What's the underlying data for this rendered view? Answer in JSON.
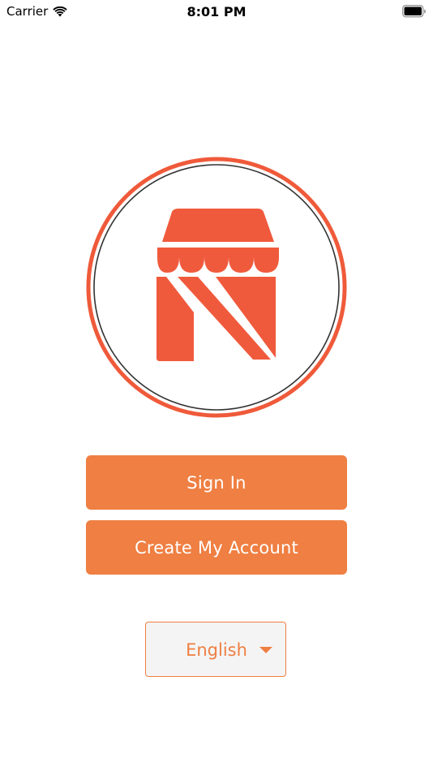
{
  "status_bar": {
    "carrier": "Carrier",
    "time": "8:01 PM",
    "icons": [
      "wifi-icon",
      "battery-icon"
    ]
  },
  "logo": {
    "icon": "storefront-logo-icon",
    "colors": {
      "ring": "#ef5a3a",
      "inner_ring": "#333333",
      "mark": "#f05a3c"
    }
  },
  "actions": {
    "sign_in_label": "Sign In",
    "create_account_label": "Create My Account"
  },
  "language": {
    "selected": "English",
    "icon": "chevron-down-icon"
  },
  "colors": {
    "accent": "#ef7f42",
    "background": "#ffffff",
    "picker_background": "#f4f4f4"
  }
}
